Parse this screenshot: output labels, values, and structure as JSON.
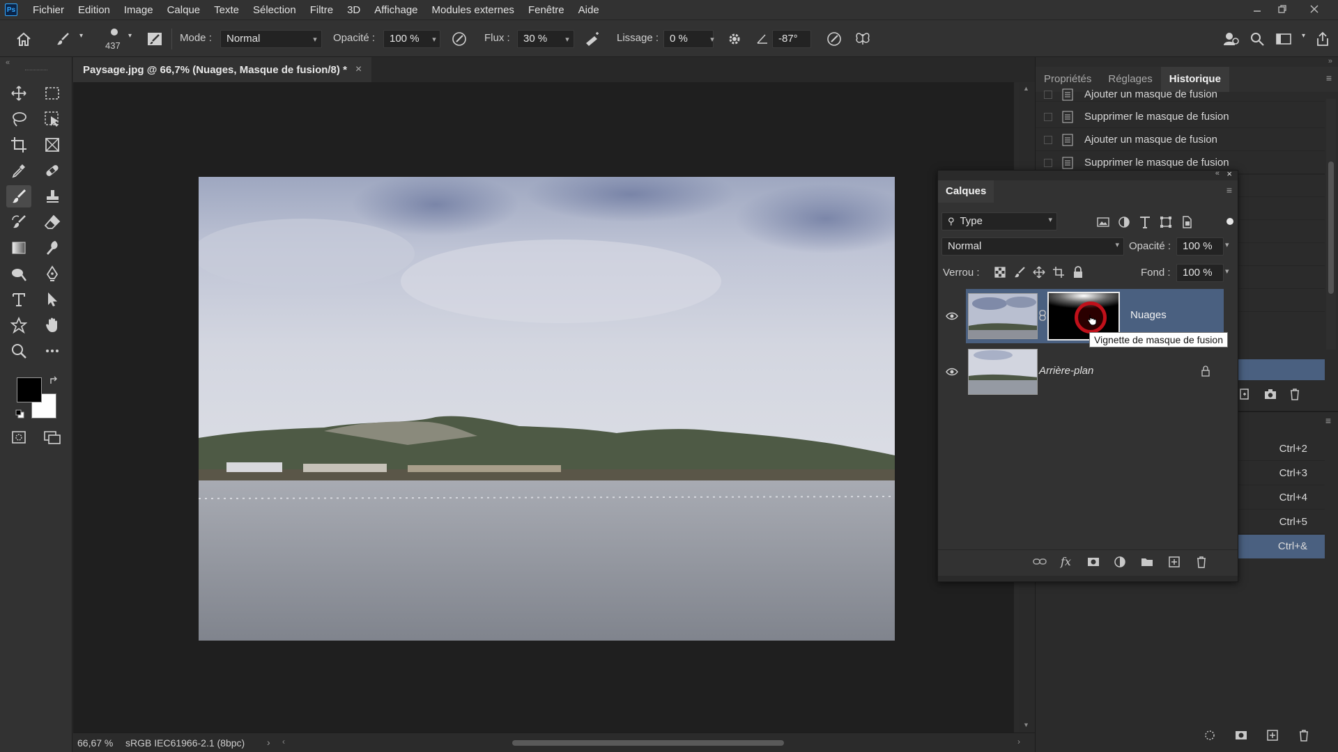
{
  "app": {
    "logo": "Ps"
  },
  "menu": [
    "Fichier",
    "Edition",
    "Image",
    "Calque",
    "Texte",
    "Sélection",
    "Filtre",
    "3D",
    "Affichage",
    "Modules externes",
    "Fenêtre",
    "Aide"
  ],
  "options": {
    "brush_size": "437",
    "mode_label": "Mode :",
    "mode_value": "Normal",
    "opacity_label": "Opacité :",
    "opacity_value": "100 %",
    "flow_label": "Flux :",
    "flow_value": "30 %",
    "smoothing_label": "Lissage :",
    "smoothing_value": "0 %",
    "angle_value": "-87°"
  },
  "document": {
    "tab_title": "Paysage.jpg @ 66,7% (Nuages, Masque de fusion/8) *",
    "close_glyph": "×"
  },
  "status": {
    "zoom": "66,67 %",
    "profile": "sRGB IEC61966-2.1 (8bpc)",
    "arrow": "›"
  },
  "right_panel": {
    "tabs": [
      "Propriétés",
      "Réglages",
      "Historique"
    ],
    "active_tab": "Historique",
    "history": [
      "Ajouter un masque de fusion",
      "Supprimer le masque de fusion",
      "Ajouter un masque de fusion",
      "Supprimer le masque de fusion"
    ],
    "shortcuts": [
      "Ctrl+2",
      "Ctrl+3",
      "Ctrl+4",
      "Ctrl+5",
      "Ctrl+&"
    ]
  },
  "layers_panel": {
    "title": "Calques",
    "filter_value": "Type",
    "blend_mode": "Normal",
    "opacity_label": "Opacité :",
    "opacity_value": "100 %",
    "lock_label": "Verrou :",
    "fill_label": "Fond :",
    "fill_value": "100 %",
    "layers": [
      {
        "name": "Nuages",
        "selected": true
      },
      {
        "name": "Arrière-plan",
        "selected": false
      }
    ],
    "tooltip": "Vignette de masque de fusion"
  },
  "colors": {
    "accent_selected": "#4a6080",
    "foreground_swatch": "#000000",
    "background_swatch": "#ffffff",
    "brush_cursor": "#c0101a"
  }
}
